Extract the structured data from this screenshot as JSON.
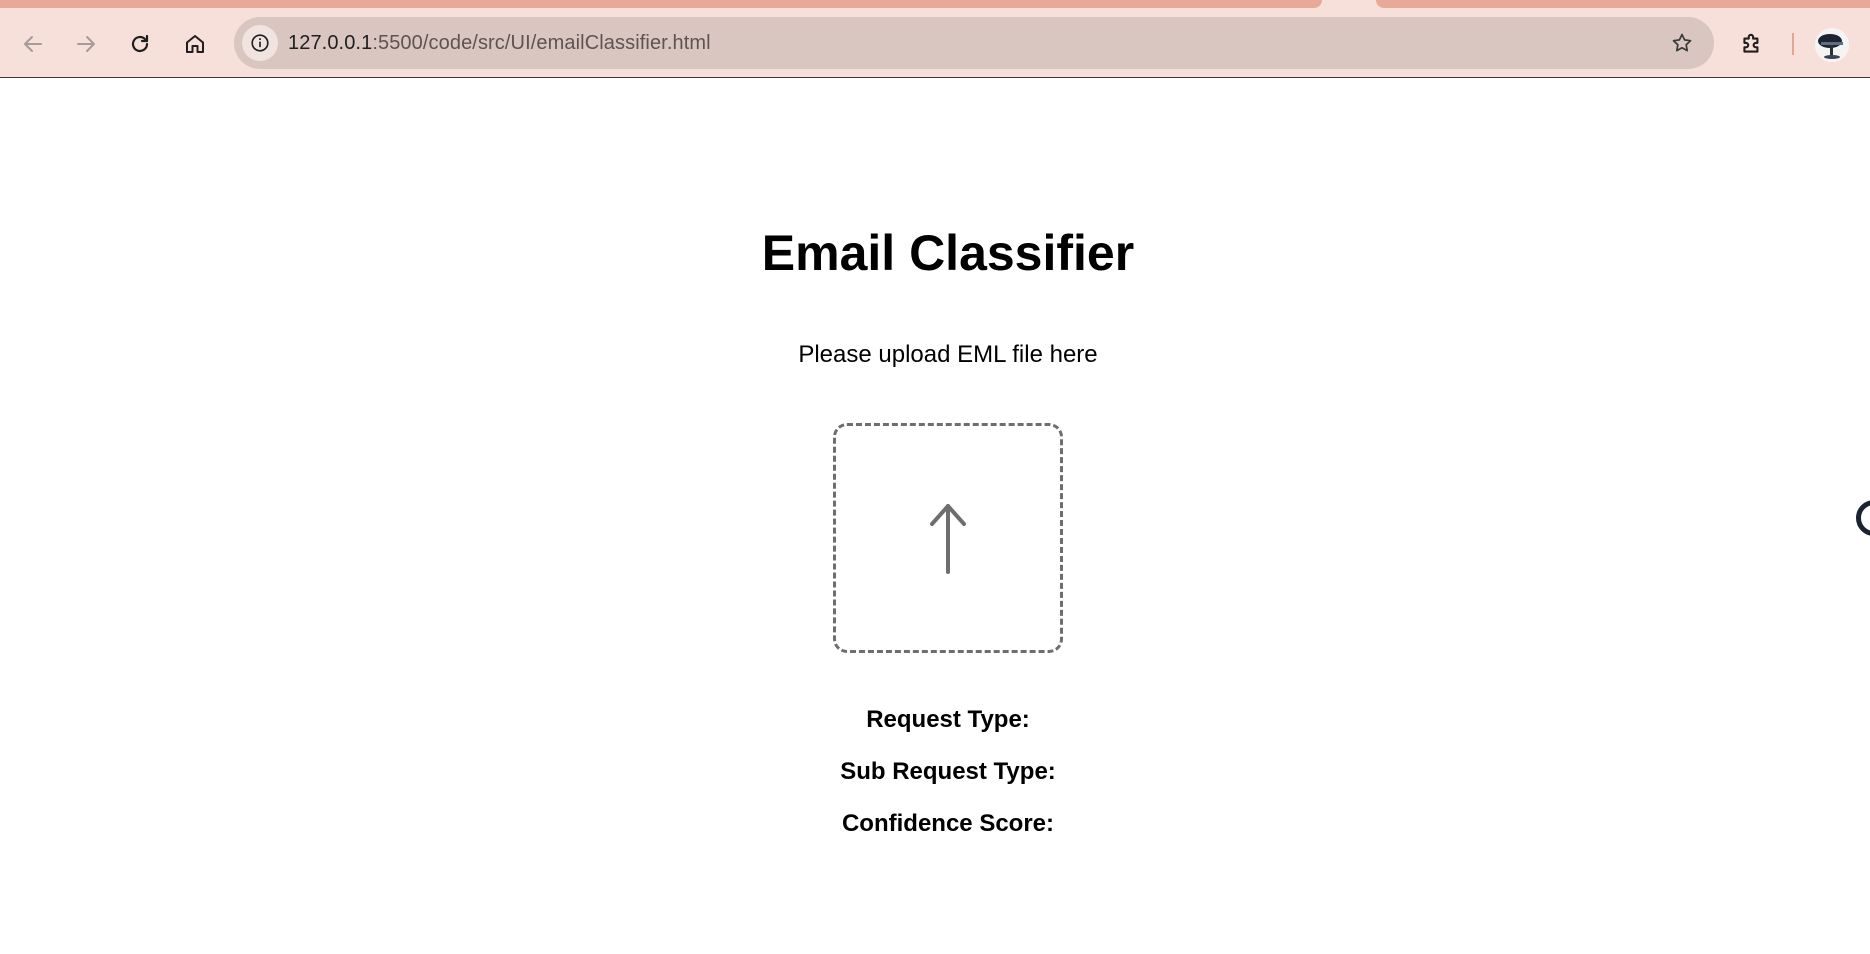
{
  "browser": {
    "url_host": "127.0.0.1",
    "url_rest": ":5500/code/src/UI/emailClassifier.html",
    "icons": {
      "back": "arrow-left-icon",
      "forward": "arrow-right-icon",
      "reload": "reload-icon",
      "home": "home-icon",
      "site_info": "info-icon",
      "bookmark": "star-icon",
      "extensions": "puzzle-icon",
      "profile": "avatar"
    },
    "colors": {
      "chrome_bg": "#f7e0d9",
      "active_tab_strip": "#e8a999",
      "omnibox_bg": "#d9c6c0"
    }
  },
  "page": {
    "title": "Email Classifier",
    "instruction": "Please upload EML file here",
    "upload_icon": "upload-arrow-icon",
    "results": {
      "request_type_label": "Request Type:",
      "sub_request_type_label": "Sub Request Type:",
      "confidence_score_label": "Confidence Score:"
    }
  }
}
